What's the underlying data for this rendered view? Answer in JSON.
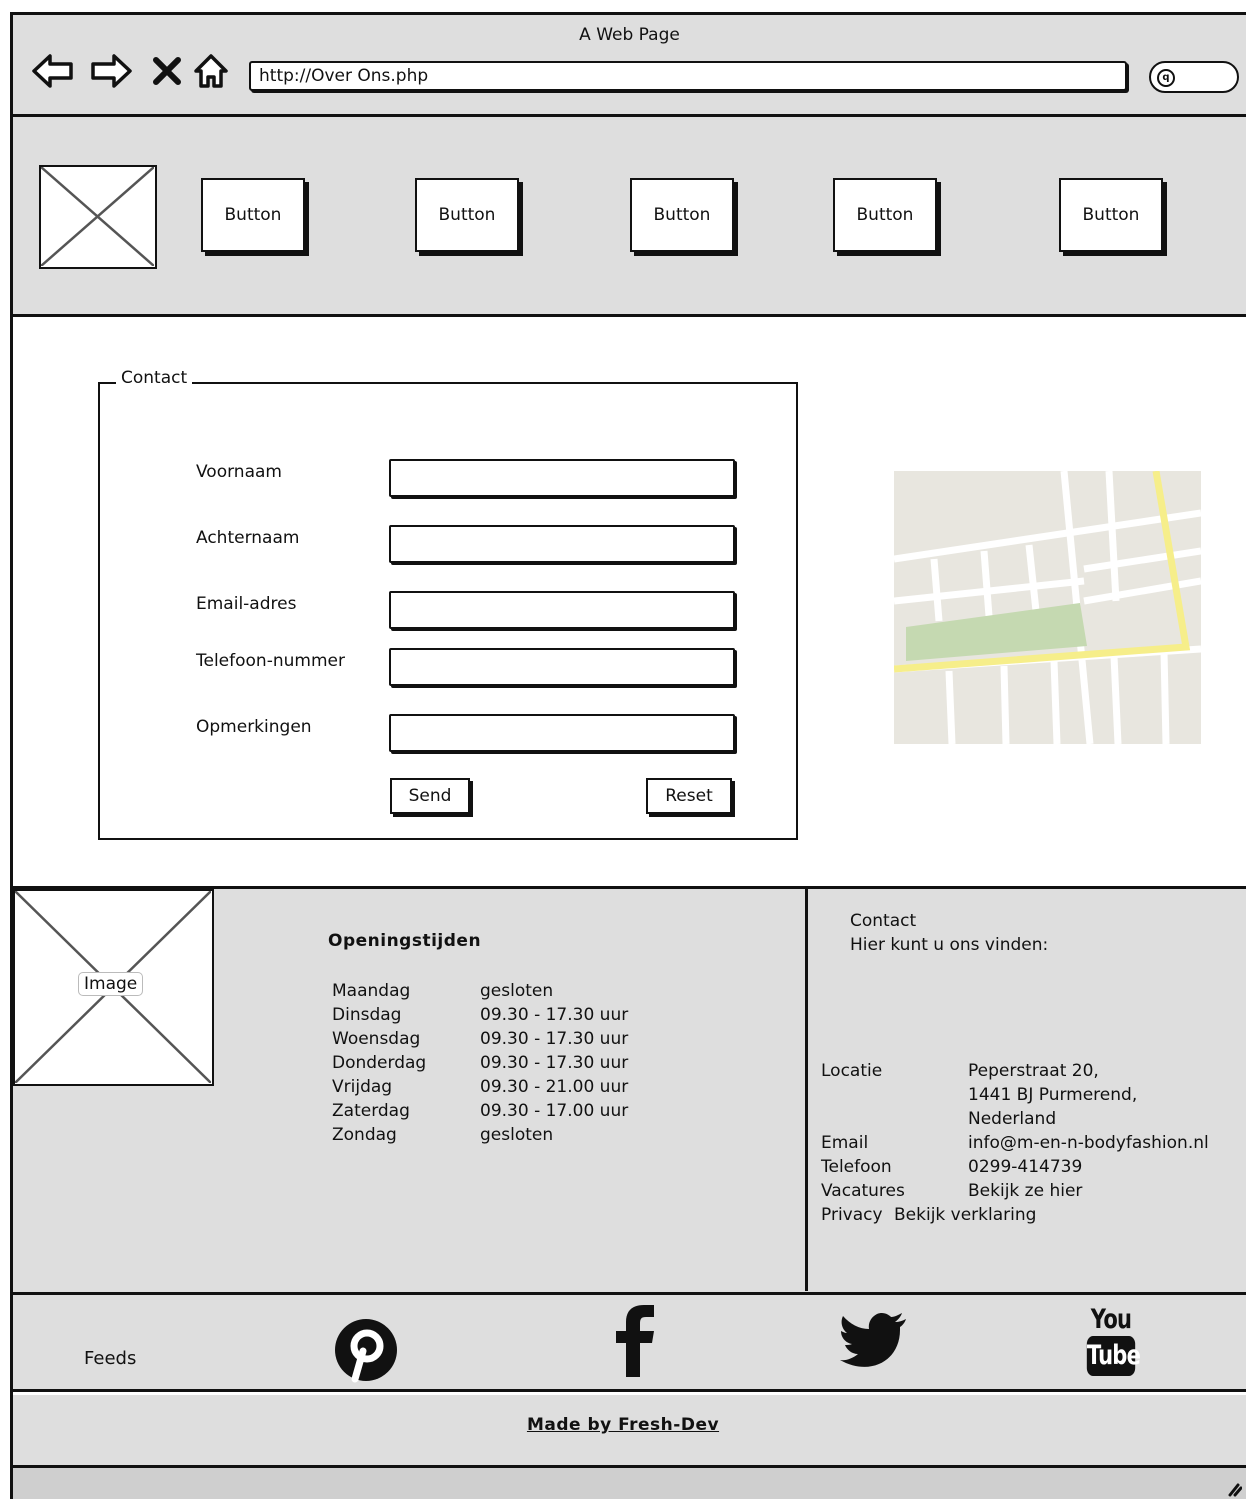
{
  "window": {
    "title": "A Web Page",
    "url": "http://Over Ons.php"
  },
  "icons": {
    "back": "back-arrow-icon",
    "forward": "forward-arrow-icon",
    "stop": "close-icon",
    "home": "home-icon",
    "search": "search-icon",
    "pinterest": "pinterest-icon",
    "facebook": "facebook-icon",
    "twitter": "twitter-icon",
    "youtube": "youtube-icon"
  },
  "nav": {
    "buttons": [
      "Button",
      "Button",
      "Button",
      "Button",
      "Button"
    ]
  },
  "contact_form": {
    "legend": "Contact",
    "fields": [
      {
        "label": "Voornaam",
        "value": ""
      },
      {
        "label": "Achternaam",
        "value": ""
      },
      {
        "label": "Email-adres",
        "value": ""
      },
      {
        "label": "Telefoon-nummer",
        "value": ""
      },
      {
        "label": "Opmerkingen",
        "value": ""
      }
    ],
    "send_label": "Send",
    "reset_label": "Reset"
  },
  "footer": {
    "image_label": "Image",
    "hours_title": "Openingstijden",
    "hours": [
      {
        "day": "Maandag",
        "time": "gesloten"
      },
      {
        "day": "Dinsdag",
        "time": "09.30 - 17.30 uur"
      },
      {
        "day": "Woensdag",
        "time": "09.30 - 17.30 uur"
      },
      {
        "day": "Donderdag",
        "time": "09.30 - 17.30 uur"
      },
      {
        "day": "Vrijdag",
        "time": "09.30 - 21.00 uur"
      },
      {
        "day": "Zaterdag",
        "time": "09.30 - 17.00 uur"
      },
      {
        "day": "Zondag",
        "time": "gesloten"
      }
    ],
    "contact_title": "Contact",
    "contact_subtitle": "Hier kunt u ons vinden:",
    "location_label": "Locatie",
    "address_line1": "Peperstraat 20,",
    "address_line2": "1441 BJ Purmerend,",
    "address_line3": "Nederland",
    "email_label": "Email",
    "email_value": "info@m-en-n-bodyfashion.nl",
    "phone_label": "Telefoon",
    "phone_value": "0299-414739",
    "vacatures_label": "Vacatures",
    "vacatures_value": "Bekijk ze hier",
    "privacy_label": "Privacy",
    "privacy_value": "Bekijk verklaring"
  },
  "feeds": {
    "label": "Feeds",
    "youtube_top": "You",
    "youtube_bottom": "Tube"
  },
  "made_by": "Made by Fresh-Dev",
  "colors": {
    "chrome_bg": "#dedede",
    "map_bg": "#e8e6df",
    "map_park": "#c5d9b1",
    "map_road_major": "#f6ee8a"
  }
}
